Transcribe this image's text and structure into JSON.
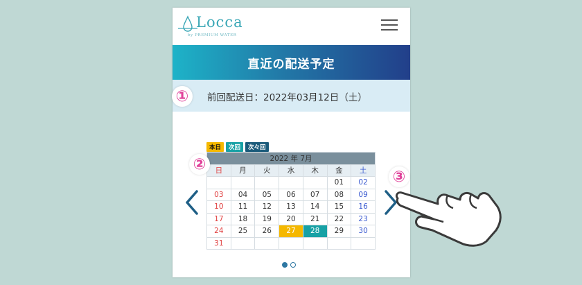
{
  "header": {
    "logo_main": "Locca",
    "logo_sub": "by PREMIUM WATER",
    "menu_icon": "hamburger-icon"
  },
  "banner": {
    "title": "直近の配送予定"
  },
  "previous_delivery": {
    "label": "前回配送日：2022年03月12日（土）"
  },
  "markers": {
    "m1": "①",
    "m2": "②",
    "m3": "③"
  },
  "legend": {
    "today": "本日",
    "next": "次回",
    "next2": "次々回"
  },
  "calendar": {
    "title": "2022 年 7月",
    "weekdays": [
      "日",
      "月",
      "火",
      "水",
      "木",
      "金",
      "土"
    ],
    "weeks": [
      [
        "",
        "",
        "",
        "",
        "",
        "01",
        "02"
      ],
      [
        "03",
        "04",
        "05",
        "06",
        "07",
        "08",
        "09"
      ],
      [
        "10",
        "11",
        "12",
        "13",
        "14",
        "15",
        "16"
      ],
      [
        "17",
        "18",
        "19",
        "20",
        "21",
        "22",
        "23"
      ],
      [
        "24",
        "25",
        "26",
        "27",
        "28",
        "29",
        "30"
      ],
      [
        "31",
        "",
        "",
        "",
        "",
        "",
        ""
      ]
    ],
    "today_date": "27",
    "next_date": "28"
  },
  "nav": {
    "prev_icon": "chevron-left-icon",
    "next_icon": "chevron-right-icon"
  },
  "pagination": {
    "current_page": 1,
    "total_pages": 2
  },
  "colors": {
    "accent": "#2f78a3",
    "today": "#f5b800",
    "next": "#17a1a5",
    "marker": "#e0419a"
  }
}
